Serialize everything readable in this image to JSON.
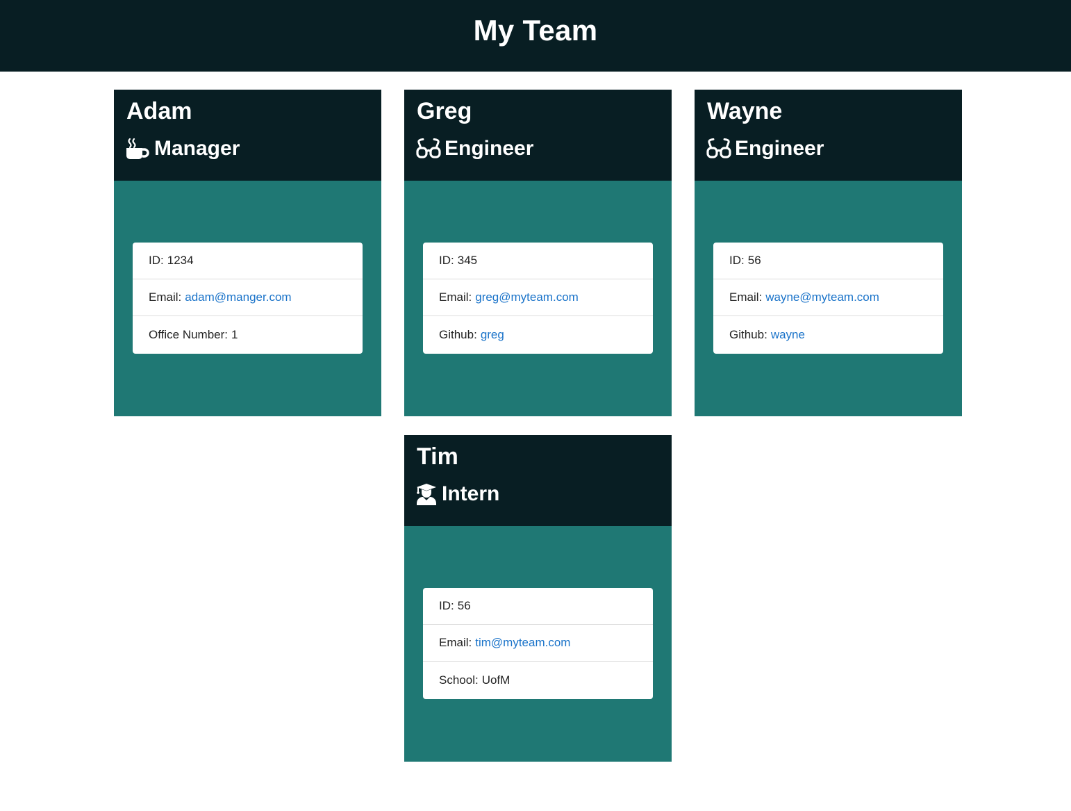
{
  "page": {
    "title": "My Team"
  },
  "cards": [
    {
      "name": "Adam",
      "role": "Manager",
      "role_icon": "mug-hot-icon",
      "id_label": "ID:",
      "id": "1234",
      "email_label": "Email:",
      "email": "adam@manger.com",
      "extra_label": "Office Number:",
      "extra": "1"
    },
    {
      "name": "Greg",
      "role": "Engineer",
      "role_icon": "glasses-icon",
      "id_label": "ID:",
      "id": "345",
      "email_label": "Email:",
      "email": "greg@myteam.com",
      "extra_label": "Github:",
      "extra": "greg"
    },
    {
      "name": "Wayne",
      "role": "Engineer",
      "role_icon": "glasses-icon",
      "id_label": "ID:",
      "id": "56",
      "email_label": "Email:",
      "email": "wayne@myteam.com",
      "extra_label": "Github:",
      "extra": "wayne"
    },
    {
      "name": "Tim",
      "role": "Intern",
      "role_icon": "user-graduate-icon",
      "id_label": "ID:",
      "id": "56",
      "email_label": "Email:",
      "email": "tim@myteam.com",
      "extra_label": "School:",
      "extra": "UofM"
    }
  ],
  "colors": {
    "header_bg": "#081e23",
    "card_body_bg": "#1f7874",
    "link": "#1a73c9"
  }
}
